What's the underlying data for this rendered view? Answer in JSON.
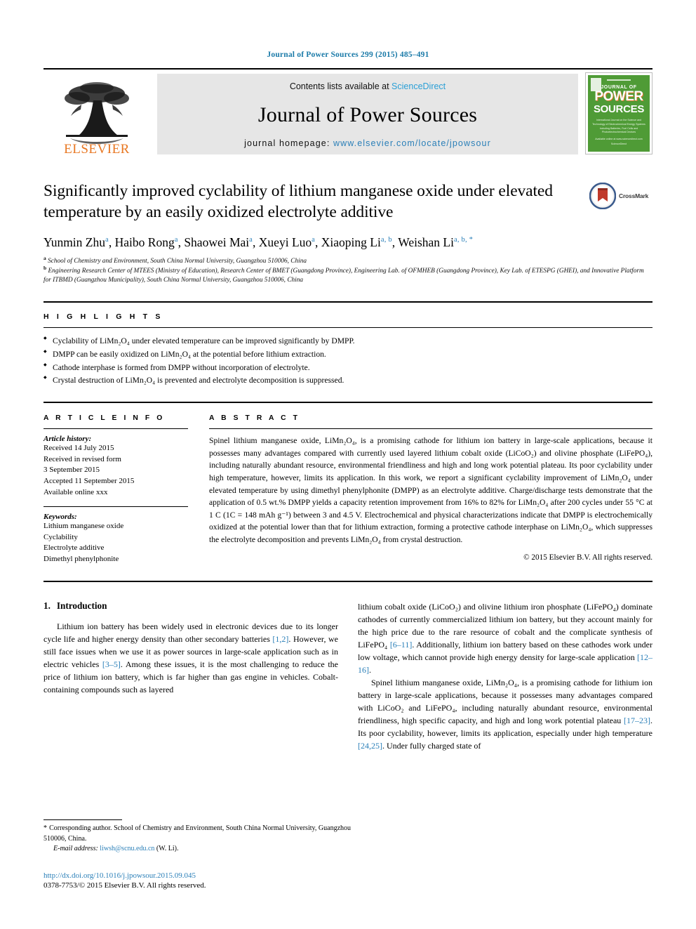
{
  "running_head": "Journal of Power Sources 299 (2015) 485–491",
  "masthead": {
    "publisher_name": "ELSEVIER",
    "contents_prefix": "Contents lists available at",
    "contents_link": "ScienceDirect",
    "journal_name": "Journal of Power Sources",
    "homepage_prefix": "journal homepage:",
    "homepage_link": "www.elsevier.com/locate/jpowsour",
    "cover": {
      "journal_of": "JOURNAL OF",
      "power": "POWER",
      "sources": "SOURCES",
      "subtitle": "International Journal on the Science and Technology of Electrochemical Energy Systems including Batteries, Fuel Cells and Photoelectrochemical Devices",
      "bottom": "Available online at www.sciencedirect.com  ScienceDirect"
    }
  },
  "article": {
    "title": "Significantly improved cyclability of lithium manganese oxide under elevated temperature by an easily oxidized electrolyte additive",
    "crossmark_label": "CrossMark",
    "authors": [
      {
        "name": "Yunmin Zhu",
        "sup": "a"
      },
      {
        "name": "Haibo Rong",
        "sup": "a"
      },
      {
        "name": "Shaowei Mai",
        "sup": "a"
      },
      {
        "name": "Xueyi Luo",
        "sup": "a"
      },
      {
        "name": "Xiaoping Li",
        "sup": "a, b"
      },
      {
        "name": "Weishan Li",
        "sup": "a, b, *"
      }
    ],
    "affiliations": [
      {
        "marker": "a",
        "text": "School of Chemistry and Environment, South China Normal University, Guangzhou 510006, China"
      },
      {
        "marker": "b",
        "text": "Engineering Research Center of MTEES (Ministry of Education), Research Center of BMET (Guangdong Province), Engineering Lab. of OFMHEB (Guangdong Province), Key Lab. of ETESPG (GHEI), and Innovative Platform for ITBMD (Guangzhou Municipality), South China Normal University, Guangzhou 510006, China"
      }
    ]
  },
  "highlights": {
    "heading": "H I G H L I G H T S",
    "items": [
      "Cyclability of LiMn₂O₄ under elevated temperature can be improved significantly by DMPP.",
      "DMPP can be easily oxidized on LiMn₂O₄ at the potential before lithium extraction.",
      "Cathode interphase is formed from DMPP without incorporation of electrolyte.",
      "Crystal destruction of LiMn₂O₄ is prevented and electrolyte decomposition is suppressed."
    ]
  },
  "article_info": {
    "heading": "A R T I C L E   I N F O",
    "history_label": "Article history:",
    "history": [
      "Received 14 July 2015",
      "Received in revised form",
      "3 September 2015",
      "Accepted 11 September 2015",
      "Available online xxx"
    ],
    "keywords_label": "Keywords:",
    "keywords": [
      "Lithium manganese oxide",
      "Cyclability",
      "Electrolyte additive",
      "Dimethyl phenylphonite"
    ]
  },
  "abstract": {
    "heading": "A B S T R A C T",
    "text": "Spinel lithium manganese oxide, LiMn₂O₄, is a promising cathode for lithium ion battery in large-scale applications, because it possesses many advantages compared with currently used layered lithium cobalt oxide (LiCoO₂) and olivine phosphate (LiFePO₄), including naturally abundant resource, environmental friendliness and high and long work potential plateau. Its poor cyclability under high temperature, however, limits its application. In this work, we report a significant cyclability improvement of LiMn₂O₄ under elevated temperature by using dimethyl phenylphonite (DMPP) as an electrolyte additive. Charge/discharge tests demonstrate that the application of 0.5 wt.% DMPP yields a capacity retention improvement from 16% to 82% for LiMn₂O₄ after 200 cycles under 55 °C at 1 C (1C = 148 mAh g⁻¹) between 3 and 4.5 V. Electrochemical and physical characterizations indicate that DMPP is electrochemically oxidized at the potential lower than that for lithium extraction, forming a protective cathode interphase on LiMn₂O₄, which suppresses the electrolyte decomposition and prevents LiMn₂O₄ from crystal destruction.",
    "copyright": "© 2015 Elsevier B.V. All rights reserved."
  },
  "introduction": {
    "number": "1.",
    "title": "Introduction",
    "paragraph_1_a": "Lithium ion battery has been widely used in electronic devices due to its longer cycle life and higher energy density than other secondary batteries ",
    "ref_1_2": "[1,2]",
    "paragraph_1_b": ". However, we still face issues when we use it as power sources in large-scale application such as in electric vehicles ",
    "ref_3_5": "[3–5]",
    "paragraph_1_c": ". Among these issues, it is the most challenging to reduce the price of lithium ion battery, which is far higher than gas engine in vehicles. Cobalt-containing compounds such as layered",
    "paragraph_2_a": "lithium cobalt oxide (LiCoO₂) and olivine lithium iron phosphate (LiFePO₄) dominate cathodes of currently commercialized lithium ion battery, but they account mainly for the high price due to the rare resource of cobalt and the complicate synthesis of LiFePO₄ ",
    "ref_6_11": "[6–11]",
    "paragraph_2_b": ". Additionally, lithium ion battery based on these cathodes work under low voltage, which cannot provide high energy density for large-scale application ",
    "ref_12_16": "[12–16]",
    "paragraph_2_c": ".",
    "paragraph_3_a": "Spinel lithium manganese oxide, LiMn₂O₄, is a promising cathode for lithium ion battery in large-scale applications, because it possesses many advantages compared with LiCoO₂ and LiFePO₄, including naturally abundant resource, environmental friendliness, high specific capacity, and high and long work potential plateau ",
    "ref_17_23": "[17–23]",
    "paragraph_3_b": ". Its poor cyclability, however, limits its application, especially under high temperature ",
    "ref_24_25": "[24,25]",
    "paragraph_3_c": ". Under fully charged state of"
  },
  "footer": {
    "corresponding_marker": "*",
    "corresponding_text": "Corresponding author. School of Chemistry and Environment, South China Normal University, Guangzhou 510006, China.",
    "email_label": "E-mail address:",
    "email": "liwsh@scnu.edu.cn",
    "email_owner": "(W. Li).",
    "doi": "http://dx.doi.org/10.1016/j.jpowsour.2015.09.045",
    "issn_line": "0378-7753/© 2015 Elsevier B.V. All rights reserved."
  },
  "colors": {
    "link_blue": "#2a7fb8",
    "sciencedirect_blue": "#2a9fd6",
    "elsevier_orange": "#e87722",
    "cover_green": "#4f9b36",
    "masthead_grey": "#e6e6e6"
  }
}
